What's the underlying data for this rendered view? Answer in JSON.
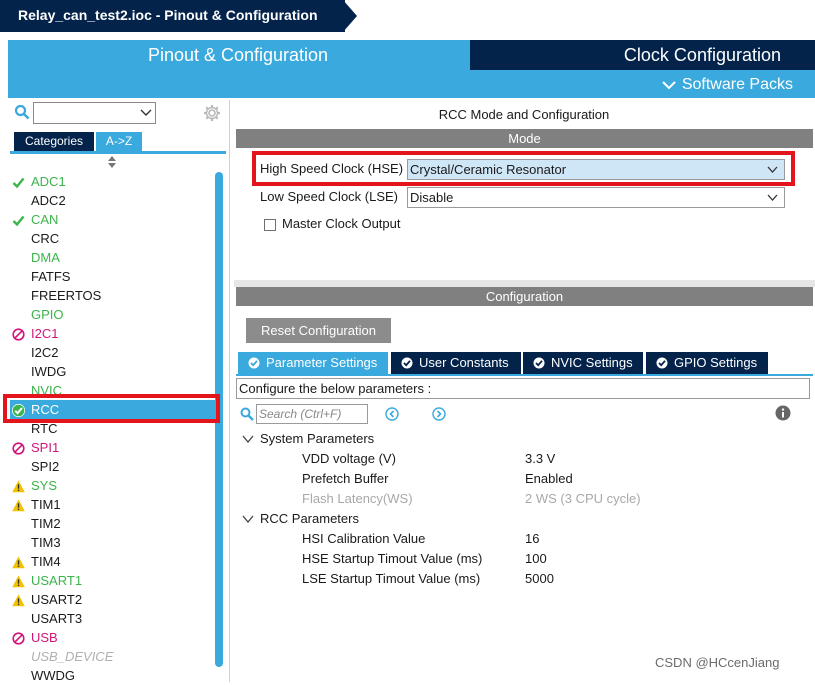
{
  "window": {
    "title": "Relay_can_test2.ioc - Pinout & Configuration"
  },
  "main_tabs": {
    "pinout": "Pinout & Configuration",
    "clock": "Clock Configuration",
    "software_packs": "Software Packs"
  },
  "left": {
    "search_value": "",
    "tab_categories": "Categories",
    "tab_az": "A->Z",
    "peripherals": [
      {
        "label": "ADC1",
        "status": "check",
        "color": "#3cb44b"
      },
      {
        "label": "ADC2",
        "status": "none",
        "color": "#1a1a1a"
      },
      {
        "label": "CAN",
        "status": "check",
        "color": "#3cb44b"
      },
      {
        "label": "CRC",
        "status": "none",
        "color": "#1a1a1a"
      },
      {
        "label": "DMA",
        "status": "none",
        "color": "#3cb44b"
      },
      {
        "label": "FATFS",
        "status": "none",
        "color": "#1a1a1a"
      },
      {
        "label": "FREERTOS",
        "status": "none",
        "color": "#1a1a1a"
      },
      {
        "label": "GPIO",
        "status": "none",
        "color": "#3cb44b"
      },
      {
        "label": "I2C1",
        "status": "blocked",
        "color": "#d0157a"
      },
      {
        "label": "I2C2",
        "status": "none",
        "color": "#1a1a1a"
      },
      {
        "label": "IWDG",
        "status": "none",
        "color": "#1a1a1a"
      },
      {
        "label": "NVIC",
        "status": "none",
        "color": "#3cb44b"
      },
      {
        "label": "RCC",
        "status": "check",
        "color": "#ffffff"
      },
      {
        "label": "RTC",
        "status": "none",
        "color": "#1a1a1a"
      },
      {
        "label": "SPI1",
        "status": "blocked",
        "color": "#d0157a"
      },
      {
        "label": "SPI2",
        "status": "none",
        "color": "#1a1a1a"
      },
      {
        "label": "SYS",
        "status": "warning",
        "color": "#3cb44b"
      },
      {
        "label": "TIM1",
        "status": "warning",
        "color": "#1a1a1a"
      },
      {
        "label": "TIM2",
        "status": "none",
        "color": "#1a1a1a"
      },
      {
        "label": "TIM3",
        "status": "none",
        "color": "#1a1a1a"
      },
      {
        "label": "TIM4",
        "status": "warning",
        "color": "#1a1a1a"
      },
      {
        "label": "USART1",
        "status": "warning",
        "color": "#3cb44b"
      },
      {
        "label": "USART2",
        "status": "warning",
        "color": "#1a1a1a"
      },
      {
        "label": "USART3",
        "status": "none",
        "color": "#1a1a1a"
      },
      {
        "label": "USB",
        "status": "blocked",
        "color": "#d0157a"
      },
      {
        "label": "USB_DEVICE",
        "status": "none",
        "color": "#b0b0b0"
      },
      {
        "label": "WWDG",
        "status": "none",
        "color": "#1a1a1a"
      }
    ],
    "selected": "RCC"
  },
  "right": {
    "panel_title": "RCC Mode and Configuration",
    "mode_header": "Mode",
    "hse_label": "High Speed Clock (HSE)",
    "hse_value": "Crystal/Ceramic Resonator",
    "lse_label": "Low Speed Clock (LSE)",
    "lse_value": "Disable",
    "mco_label": "Master Clock Output",
    "config_header": "Configuration",
    "reset_button": "Reset Configuration",
    "param_tabs": [
      "Parameter Settings",
      "User Constants",
      "NVIC Settings",
      "GPIO Settings"
    ],
    "configure_text": "Configure the below parameters :",
    "search_placeholder": "Search (Ctrl+F)",
    "groups": [
      {
        "name": "System Parameters",
        "params": [
          {
            "name": "VDD voltage (V)",
            "value": "3.3 V",
            "disabled": false
          },
          {
            "name": "Prefetch Buffer",
            "value": "Enabled",
            "disabled": false
          },
          {
            "name": "Flash Latency(WS)",
            "value": "2 WS (3 CPU cycle)",
            "disabled": true
          }
        ]
      },
      {
        "name": "RCC Parameters",
        "params": [
          {
            "name": "HSI Calibration Value",
            "value": "16",
            "disabled": false
          },
          {
            "name": "HSE Startup Timout Value (ms)",
            "value": "100",
            "disabled": false
          },
          {
            "name": "LSE Startup Timout Value (ms)",
            "value": "5000",
            "disabled": false
          }
        ]
      }
    ]
  },
  "watermark": "CSDN @HCcenJiang",
  "colors": {
    "navy": "#03234b",
    "accent_blue": "#3aa9dd",
    "highlight_red": "#e3141c",
    "ok_green": "#3cb44b",
    "warn_yellow": "#f2c200",
    "blocked_magenta": "#d0157a"
  }
}
